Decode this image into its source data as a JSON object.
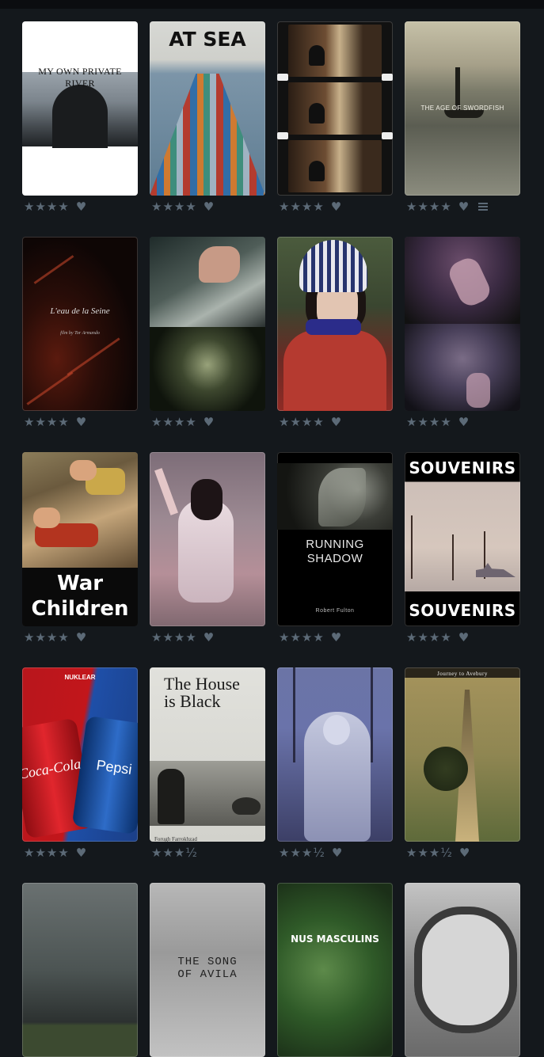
{
  "films": [
    {
      "title": "MY OWN PRIVATE RIVER",
      "rating": "★★★★",
      "liked": true,
      "reviewed": false
    },
    {
      "title": "AT SEA",
      "rating": "★★★★",
      "liked": true,
      "reviewed": false
    },
    {
      "title": "",
      "rating": "★★★★",
      "liked": true,
      "reviewed": false
    },
    {
      "title": "THE AGE OF SWORDFISH",
      "rating": "★★★★",
      "liked": true,
      "reviewed": true
    },
    {
      "title": "L'eau de la Seine",
      "subtitle": "film by Tor Armando",
      "rating": "★★★★",
      "liked": true,
      "reviewed": false
    },
    {
      "title": "",
      "rating": "★★★★",
      "liked": true,
      "reviewed": false
    },
    {
      "title": "",
      "rating": "★★★★",
      "liked": true,
      "reviewed": false
    },
    {
      "title": "",
      "rating": "★★★★",
      "liked": true,
      "reviewed": false
    },
    {
      "title": "War Children",
      "rating": "★★★★",
      "liked": true,
      "reviewed": false
    },
    {
      "title": "",
      "rating": "★★★★",
      "liked": true,
      "reviewed": false
    },
    {
      "title": "RUNNING SHADOW",
      "subtitle": "Robert Fulton",
      "rating": "★★★★",
      "liked": true,
      "reviewed": false
    },
    {
      "title": "SOUVENIRS",
      "rating": "★★★★",
      "liked": true,
      "reviewed": false
    },
    {
      "title": "Coca-Cola",
      "subtitle": "Pepsi",
      "tag": "NUKLEAR",
      "rating": "★★★★",
      "liked": true,
      "reviewed": false
    },
    {
      "title": "The House is Black",
      "subtitle": "Forugh Farrokhzad",
      "rating": "★★★½",
      "liked": false,
      "reviewed": false
    },
    {
      "title": "",
      "rating": "★★★½",
      "liked": true,
      "reviewed": false
    },
    {
      "title": "Journey to Avebury",
      "rating": "★★★½",
      "liked": true,
      "reviewed": false
    },
    {
      "title": ""
    },
    {
      "title": "THE SONG OF AVILA"
    },
    {
      "title": "NUS MASCULINS"
    },
    {
      "title": ""
    }
  ],
  "icons": {
    "heart": "♥",
    "review": "review-lines-icon"
  },
  "colors": {
    "background": "#14181c",
    "meta": "#5c6a77"
  }
}
